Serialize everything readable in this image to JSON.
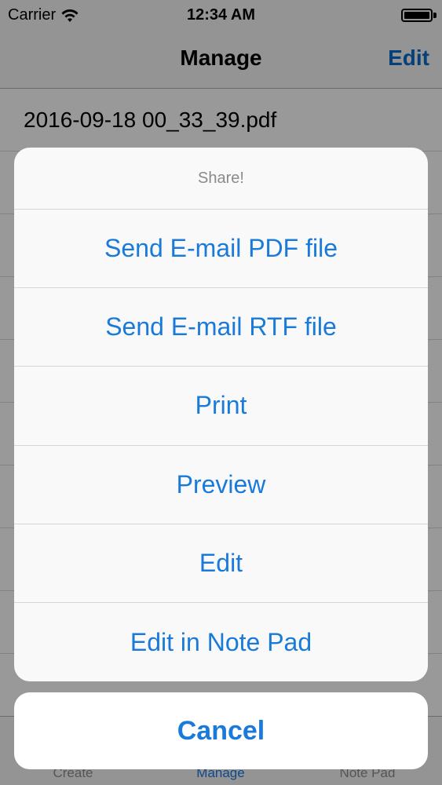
{
  "status_bar": {
    "carrier": "Carrier",
    "time": "12:34 AM",
    "icons": [
      "wifi-icon",
      "battery-icon"
    ]
  },
  "nav_bar": {
    "title": "Manage",
    "edit_label": "Edit"
  },
  "file_list": {
    "items": [
      "2016-09-18 00_33_39.pdf"
    ]
  },
  "action_sheet": {
    "title": "Share!",
    "actions": [
      "Send E-mail PDF file",
      "Send E-mail RTF file",
      "Print",
      "Preview",
      "Edit",
      "Edit in Note Pad"
    ],
    "cancel_label": "Cancel"
  },
  "tab_bar": {
    "tabs": [
      "Create",
      "Manage",
      "Note Pad"
    ],
    "selected": "Manage"
  },
  "colors": {
    "accent": "#1a7ad9",
    "overlay": "rgba(0,0,0,0.40)",
    "title_gray": "#8a8a8a"
  }
}
